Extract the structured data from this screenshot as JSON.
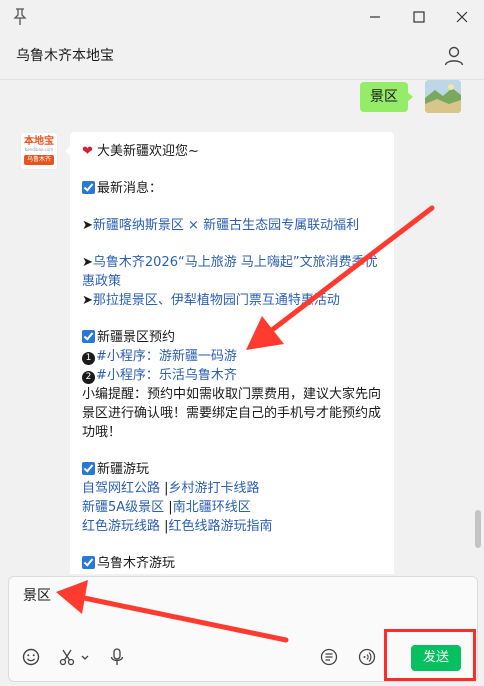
{
  "window": {
    "title": "乌鲁木齐本地宝",
    "icons": [
      "pin-icon",
      "minimize-icon",
      "maximize-icon",
      "close-icon",
      "user-icon"
    ]
  },
  "chat": {
    "sent_message": "景区",
    "bot": {
      "brand": "本地宝",
      "url": "bendibao.com",
      "tag": "乌鲁木齐"
    },
    "reply": {
      "welcome": "大美新疆欢迎您~",
      "news_heading": "最新消息：",
      "news_items": [
        "新疆喀纳斯景区 × 新疆古生态园专属联动福利",
        "乌鲁木齐2026“马上旅游 马上嗨起”文旅消费季优惠政策",
        "那拉提景区、伊犁植物园门票互通特惠活动"
      ],
      "booking_heading": "新疆景区预约",
      "booking_items": [
        {
          "num": "1",
          "prefix": "#小程序：",
          "name": "游新疆一码游"
        },
        {
          "num": "2",
          "prefix": "#小程序：",
          "name": "乐活乌鲁木齐"
        }
      ],
      "booking_tip": "小编提醒：预约中如需收取门票费用，建议大家先向景区进行确认哦！需要绑定自己的手机号才能预约成功哦！",
      "travel_heading": "新疆游玩",
      "travel_rows": [
        [
          "自驾网红公路",
          "乡村游打卡线路"
        ],
        [
          "新疆5A级景区",
          "南北疆环线区"
        ],
        [
          "红色游玩线路",
          "红色线路游玩指南"
        ]
      ],
      "next_heading": "乌鲁木齐游玩"
    }
  },
  "input": {
    "value": "景区",
    "send_label": "发送",
    "tool_icons": [
      "emoji-icon",
      "scissors-icon",
      "chevron-down-icon",
      "microphone-icon",
      "chat-history-icon",
      "voice-call-icon"
    ]
  },
  "colors": {
    "send_button": "#07c160",
    "sent_bubble": "#95ec69",
    "link": "#2b5fb3",
    "annotation": "#ff2a2a"
  }
}
